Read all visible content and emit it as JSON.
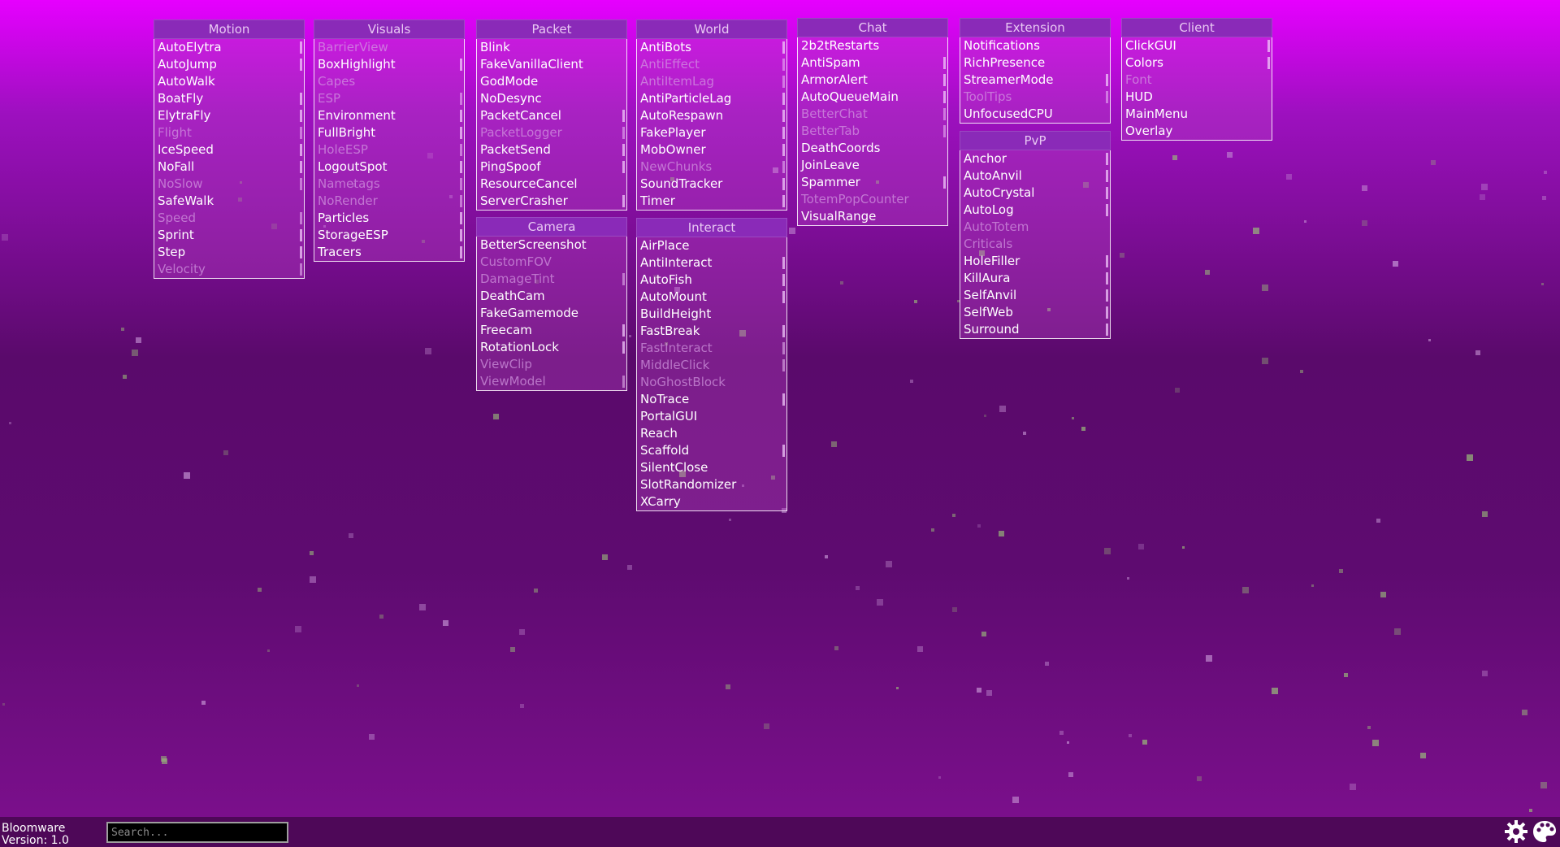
{
  "theme": {
    "accent": "#8a2ab8",
    "enabled_text": "#ffffff",
    "disabled_text": "#d49be2"
  },
  "panels": [
    {
      "id": "motion",
      "title": "Motion",
      "items": [
        {
          "label": "AutoElytra",
          "enabled": true,
          "settings": true
        },
        {
          "label": "AutoJump",
          "enabled": true,
          "settings": true
        },
        {
          "label": "AutoWalk",
          "enabled": true,
          "settings": false
        },
        {
          "label": "BoatFly",
          "enabled": true,
          "settings": true
        },
        {
          "label": "ElytraFly",
          "enabled": true,
          "settings": true
        },
        {
          "label": "Flight",
          "enabled": false,
          "settings": true
        },
        {
          "label": "IceSpeed",
          "enabled": true,
          "settings": true
        },
        {
          "label": "NoFall",
          "enabled": true,
          "settings": true
        },
        {
          "label": "NoSlow",
          "enabled": false,
          "settings": true
        },
        {
          "label": "SafeWalk",
          "enabled": true,
          "settings": false
        },
        {
          "label": "Speed",
          "enabled": false,
          "settings": true
        },
        {
          "label": "Sprint",
          "enabled": true,
          "settings": true
        },
        {
          "label": "Step",
          "enabled": true,
          "settings": true
        },
        {
          "label": "Velocity",
          "enabled": false,
          "settings": true
        }
      ]
    },
    {
      "id": "visuals",
      "title": "Visuals",
      "items": [
        {
          "label": "BarrierView",
          "enabled": false,
          "settings": false
        },
        {
          "label": "BoxHighlight",
          "enabled": true,
          "settings": true
        },
        {
          "label": "Capes",
          "enabled": false,
          "settings": false
        },
        {
          "label": "ESP",
          "enabled": false,
          "settings": true
        },
        {
          "label": "Environment",
          "enabled": true,
          "settings": true
        },
        {
          "label": "FullBright",
          "enabled": true,
          "settings": true
        },
        {
          "label": "HoleESP",
          "enabled": false,
          "settings": true
        },
        {
          "label": "LogoutSpot",
          "enabled": true,
          "settings": true
        },
        {
          "label": "Nametags",
          "enabled": false,
          "settings": true
        },
        {
          "label": "NoRender",
          "enabled": false,
          "settings": true
        },
        {
          "label": "Particles",
          "enabled": true,
          "settings": true
        },
        {
          "label": "StorageESP",
          "enabled": true,
          "settings": true
        },
        {
          "label": "Tracers",
          "enabled": true,
          "settings": true
        }
      ]
    },
    {
      "id": "packet",
      "title": "Packet",
      "items": [
        {
          "label": "Blink",
          "enabled": true,
          "settings": false
        },
        {
          "label": "FakeVanillaClient",
          "enabled": true,
          "settings": false
        },
        {
          "label": "GodMode",
          "enabled": true,
          "settings": false
        },
        {
          "label": "NoDesync",
          "enabled": true,
          "settings": false
        },
        {
          "label": "PacketCancel",
          "enabled": true,
          "settings": true
        },
        {
          "label": "PacketLogger",
          "enabled": false,
          "settings": true
        },
        {
          "label": "PacketSend",
          "enabled": true,
          "settings": true
        },
        {
          "label": "PingSpoof",
          "enabled": true,
          "settings": true
        },
        {
          "label": "ResourceCancel",
          "enabled": true,
          "settings": false
        },
        {
          "label": "ServerCrasher",
          "enabled": true,
          "settings": true
        }
      ]
    },
    {
      "id": "camera",
      "title": "Camera",
      "items": [
        {
          "label": "BetterScreenshot",
          "enabled": true,
          "settings": false
        },
        {
          "label": "CustomFOV",
          "enabled": false,
          "settings": false
        },
        {
          "label": "DamageTint",
          "enabled": false,
          "settings": true
        },
        {
          "label": "DeathCam",
          "enabled": true,
          "settings": false
        },
        {
          "label": "FakeGamemode",
          "enabled": true,
          "settings": false
        },
        {
          "label": "Freecam",
          "enabled": true,
          "settings": true
        },
        {
          "label": "RotationLock",
          "enabled": true,
          "settings": true
        },
        {
          "label": "ViewClip",
          "enabled": false,
          "settings": false
        },
        {
          "label": "ViewModel",
          "enabled": false,
          "settings": true
        }
      ]
    },
    {
      "id": "world",
      "title": "World",
      "items": [
        {
          "label": "AntiBots",
          "enabled": true,
          "settings": true
        },
        {
          "label": "AntiEffect",
          "enabled": false,
          "settings": true
        },
        {
          "label": "AntiItemLag",
          "enabled": false,
          "settings": true
        },
        {
          "label": "AntiParticleLag",
          "enabled": true,
          "settings": true
        },
        {
          "label": "AutoRespawn",
          "enabled": true,
          "settings": true
        },
        {
          "label": "FakePlayer",
          "enabled": true,
          "settings": true
        },
        {
          "label": "MobOwner",
          "enabled": true,
          "settings": true
        },
        {
          "label": "NewChunks",
          "enabled": false,
          "settings": true
        },
        {
          "label": "SoundTracker",
          "enabled": true,
          "settings": true
        },
        {
          "label": "Timer",
          "enabled": true,
          "settings": true
        }
      ]
    },
    {
      "id": "interact",
      "title": "Interact",
      "items": [
        {
          "label": "AirPlace",
          "enabled": true,
          "settings": false
        },
        {
          "label": "AntiInteract",
          "enabled": true,
          "settings": true
        },
        {
          "label": "AutoFish",
          "enabled": true,
          "settings": true
        },
        {
          "label": "AutoMount",
          "enabled": true,
          "settings": true
        },
        {
          "label": "BuildHeight",
          "enabled": true,
          "settings": false
        },
        {
          "label": "FastBreak",
          "enabled": true,
          "settings": true
        },
        {
          "label": "FastInteract",
          "enabled": false,
          "settings": true
        },
        {
          "label": "MiddleClick",
          "enabled": false,
          "settings": true
        },
        {
          "label": "NoGhostBlock",
          "enabled": false,
          "settings": false
        },
        {
          "label": "NoTrace",
          "enabled": true,
          "settings": true
        },
        {
          "label": "PortalGUI",
          "enabled": true,
          "settings": false
        },
        {
          "label": "Reach",
          "enabled": true,
          "settings": false
        },
        {
          "label": "Scaffold",
          "enabled": true,
          "settings": true
        },
        {
          "label": "SilentClose",
          "enabled": true,
          "settings": false
        },
        {
          "label": "SlotRandomizer",
          "enabled": true,
          "settings": false
        },
        {
          "label": "XCarry",
          "enabled": true,
          "settings": false
        }
      ]
    },
    {
      "id": "chat",
      "title": "Chat",
      "items": [
        {
          "label": "2b2tRestarts",
          "enabled": true,
          "settings": false
        },
        {
          "label": "AntiSpam",
          "enabled": true,
          "settings": true
        },
        {
          "label": "ArmorAlert",
          "enabled": true,
          "settings": true
        },
        {
          "label": "AutoQueueMain",
          "enabled": true,
          "settings": true
        },
        {
          "label": "BetterChat",
          "enabled": false,
          "settings": true
        },
        {
          "label": "BetterTab",
          "enabled": false,
          "settings": true
        },
        {
          "label": "DeathCoords",
          "enabled": true,
          "settings": false
        },
        {
          "label": "JoinLeave",
          "enabled": true,
          "settings": false
        },
        {
          "label": "Spammer",
          "enabled": true,
          "settings": true
        },
        {
          "label": "TotemPopCounter",
          "enabled": false,
          "settings": false
        },
        {
          "label": "VisualRange",
          "enabled": true,
          "settings": false
        }
      ]
    },
    {
      "id": "extension",
      "title": "Extension",
      "items": [
        {
          "label": "Notifications",
          "enabled": true,
          "settings": false
        },
        {
          "label": "RichPresence",
          "enabled": true,
          "settings": false
        },
        {
          "label": "StreamerMode",
          "enabled": true,
          "settings": true
        },
        {
          "label": "ToolTips",
          "enabled": false,
          "settings": true
        },
        {
          "label": "UnfocusedCPU",
          "enabled": true,
          "settings": false
        }
      ]
    },
    {
      "id": "pvp",
      "title": "PvP",
      "items": [
        {
          "label": "Anchor",
          "enabled": true,
          "settings": true
        },
        {
          "label": "AutoAnvil",
          "enabled": true,
          "settings": true
        },
        {
          "label": "AutoCrystal",
          "enabled": true,
          "settings": true
        },
        {
          "label": "AutoLog",
          "enabled": true,
          "settings": true
        },
        {
          "label": "AutoTotem",
          "enabled": false,
          "settings": false
        },
        {
          "label": "Criticals",
          "enabled": false,
          "settings": false
        },
        {
          "label": "HoleFiller",
          "enabled": true,
          "settings": true
        },
        {
          "label": "KillAura",
          "enabled": true,
          "settings": true
        },
        {
          "label": "SelfAnvil",
          "enabled": true,
          "settings": true
        },
        {
          "label": "SelfWeb",
          "enabled": true,
          "settings": true
        },
        {
          "label": "Surround",
          "enabled": true,
          "settings": true
        }
      ]
    },
    {
      "id": "client",
      "title": "Client",
      "items": [
        {
          "label": "ClickGUI",
          "enabled": true,
          "settings": true
        },
        {
          "label": "Colors",
          "enabled": true,
          "settings": true
        },
        {
          "label": "Font",
          "enabled": false,
          "settings": false
        },
        {
          "label": "HUD",
          "enabled": true,
          "settings": false
        },
        {
          "label": "MainMenu",
          "enabled": true,
          "settings": false
        },
        {
          "label": "Overlay",
          "enabled": true,
          "settings": false
        }
      ]
    }
  ],
  "footer": {
    "client_name": "Bloomware",
    "version": "Version: 1.0",
    "search_placeholder": "Search..."
  },
  "icons": {
    "settings": "gear-icon",
    "theme": "palette-icon"
  }
}
